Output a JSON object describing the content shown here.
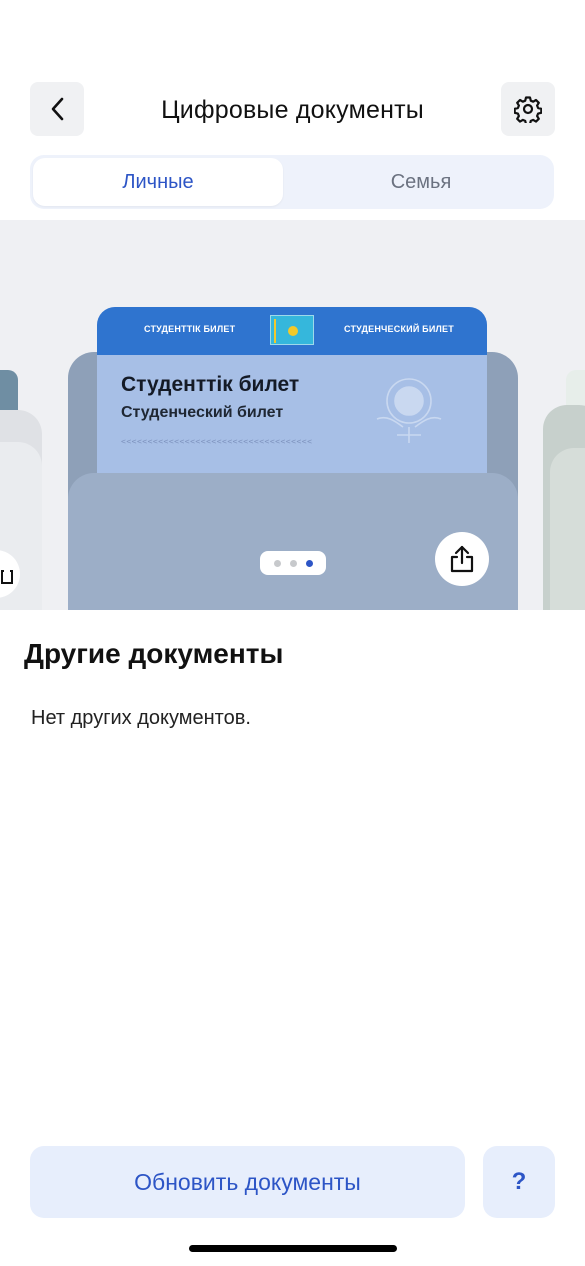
{
  "header": {
    "title": "Цифровые документы",
    "back_icon": "chevron-left-icon",
    "settings_icon": "gear-icon"
  },
  "tabs": [
    {
      "label": "Личные",
      "active": true
    },
    {
      "label": "Семья",
      "active": false
    }
  ],
  "carousel": {
    "card": {
      "band_left": "СТУДЕНТТІК БИЛЕТ",
      "band_right": "СТУДЕНЧЕСКИЙ БИЛЕТ",
      "title": "Студенттік билет",
      "subtitle": "Студенческий билет",
      "mrz": "<<<<<<<<<<<<<<<<<<<<<<<<<<<<<<<<<<<<"
    },
    "pages": 3,
    "active_page": 3,
    "share_icon": "share-icon"
  },
  "other_documents": {
    "title": "Другие документы",
    "empty_text": "Нет других документов."
  },
  "bottom": {
    "refresh_label": "Обновить документы",
    "help_label": "?"
  },
  "colors": {
    "accent": "#2d55c6",
    "card_band": "#2f74cf",
    "card_body": "#a7bfe6"
  }
}
